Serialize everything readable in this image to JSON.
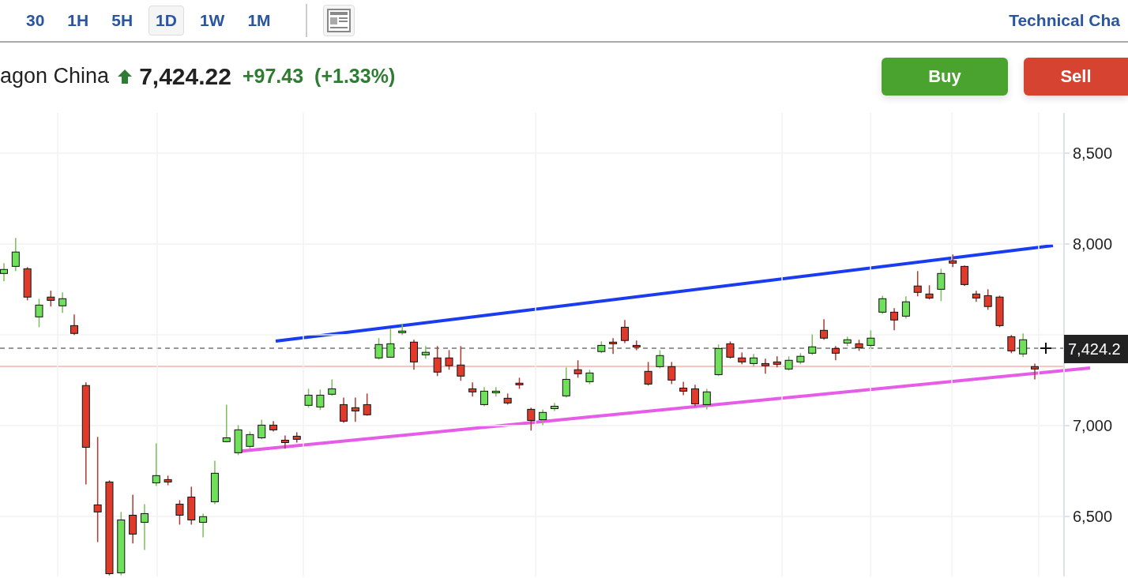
{
  "timeframes": [
    {
      "label": "30",
      "selected": false
    },
    {
      "label": "1H",
      "selected": false
    },
    {
      "label": "5H",
      "selected": false
    },
    {
      "label": "1D",
      "selected": true
    },
    {
      "label": "1W",
      "selected": false
    },
    {
      "label": "1M",
      "selected": false
    }
  ],
  "link": "Technical Cha",
  "quote": {
    "name": "agon China",
    "rising": true,
    "price": "7,424.22",
    "change": "+97.43",
    "change_percent": "(+1.33%)"
  },
  "actions": [
    {
      "label": "Buy",
      "kind": "buy"
    },
    {
      "label": "Sell",
      "kind": "sell"
    }
  ],
  "chart": {
    "last_price": "7,424.2",
    "trendlines": [
      {
        "color": "#1a3cf0"
      },
      {
        "color": "#e65ce8"
      }
    ],
    "chart_data": {
      "type": "candlestick",
      "grid": true,
      "ylim": [
        6170,
        8722
      ],
      "yticks": [
        {
          "value": 8500,
          "label": "8,500"
        },
        {
          "value": 8000,
          "label": "8,000"
        },
        {
          "value": 7000,
          "label": "7,000"
        },
        {
          "value": 6500,
          "label": "6,500"
        }
      ],
      "ohlc": [
        [
          7838,
          7895,
          7795,
          7860
        ],
        [
          7877,
          8034,
          7851,
          7956
        ],
        [
          7864,
          7873,
          7690,
          7708
        ],
        [
          7599,
          7699,
          7542,
          7664
        ],
        [
          7708,
          7743,
          7656,
          7690
        ],
        [
          7660,
          7734,
          7621,
          7699
        ],
        [
          7551,
          7612,
          7499,
          7508
        ],
        [
          7221,
          7238,
          6677,
          6881
        ],
        [
          6564,
          6938,
          6359,
          6525
        ],
        [
          6690,
          6699,
          6176,
          6185
        ],
        [
          6190,
          6525,
          6176,
          6481
        ],
        [
          6507,
          6620,
          6351,
          6403
        ],
        [
          6468,
          6568,
          6316,
          6516
        ],
        [
          6685,
          6903,
          6668,
          6725
        ],
        [
          6703,
          6725,
          6672,
          6690
        ],
        [
          6568,
          6590,
          6455,
          6507
        ],
        [
          6607,
          6664,
          6455,
          6481
        ],
        [
          6468,
          6516,
          6385,
          6499
        ],
        [
          6581,
          6807,
          6568,
          6738
        ],
        [
          6912,
          7116,
          6908,
          6933
        ],
        [
          6851,
          7003,
          6838,
          6977
        ],
        [
          6886,
          6968,
          6873,
          6951
        ],
        [
          6933,
          7033,
          6925,
          7003
        ],
        [
          7003,
          7025,
          6968,
          6977
        ],
        [
          6920,
          6946,
          6873,
          6907
        ],
        [
          6942,
          6964,
          6907,
          6925
        ],
        [
          7112,
          7203,
          7099,
          7168
        ],
        [
          7103,
          7199,
          7086,
          7168
        ],
        [
          7173,
          7255,
          7164,
          7203
        ],
        [
          7116,
          7155,
          7016,
          7025
        ],
        [
          7099,
          7155,
          7021,
          7081
        ],
        [
          7116,
          7177,
          7055,
          7060
        ],
        [
          7373,
          7482,
          7364,
          7447
        ],
        [
          7377,
          7534,
          7373,
          7451
        ],
        [
          7512,
          7560,
          7499,
          7521
        ],
        [
          7460,
          7473,
          7308,
          7351
        ],
        [
          7390,
          7438,
          7369,
          7404
        ],
        [
          7373,
          7438,
          7273,
          7295
        ],
        [
          7373,
          7416,
          7308,
          7330
        ],
        [
          7334,
          7438,
          7247,
          7273
        ],
        [
          7203,
          7238,
          7160,
          7186
        ],
        [
          7116,
          7212,
          7107,
          7190
        ],
        [
          7181,
          7212,
          7160,
          7190
        ],
        [
          7151,
          7177,
          7116,
          7125
        ],
        [
          7234,
          7264,
          7203,
          7225
        ],
        [
          7090,
          7099,
          6973,
          7029
        ],
        [
          7033,
          7090,
          7003,
          7073
        ],
        [
          7094,
          7125,
          7081,
          7107
        ],
        [
          7164,
          7321,
          7155,
          7255
        ],
        [
          7308,
          7360,
          7264,
          7286
        ],
        [
          7242,
          7308,
          7229,
          7290
        ],
        [
          7408,
          7464,
          7399,
          7442
        ],
        [
          7460,
          7482,
          7395,
          7451
        ],
        [
          7542,
          7582,
          7455,
          7469
        ],
        [
          7442,
          7469,
          7416,
          7434
        ],
        [
          7299,
          7351,
          7221,
          7229
        ],
        [
          7325,
          7416,
          7316,
          7386
        ],
        [
          7325,
          7351,
          7229,
          7251
        ],
        [
          7207,
          7242,
          7168,
          7190
        ],
        [
          7203,
          7225,
          7107,
          7120
        ],
        [
          7116,
          7203,
          7090,
          7186
        ],
        [
          7281,
          7447,
          7273,
          7425
        ],
        [
          7451,
          7464,
          7369,
          7377
        ],
        [
          7373,
          7403,
          7338,
          7351
        ],
        [
          7342,
          7395,
          7325,
          7373
        ],
        [
          7342,
          7369,
          7286,
          7330
        ],
        [
          7351,
          7382,
          7321,
          7338
        ],
        [
          7312,
          7382,
          7303,
          7360
        ],
        [
          7351,
          7399,
          7338,
          7382
        ],
        [
          7399,
          7503,
          7390,
          7434
        ],
        [
          7525,
          7586,
          7473,
          7482
        ],
        [
          7425,
          7438,
          7360,
          7399
        ],
        [
          7455,
          7490,
          7438,
          7473
        ],
        [
          7451,
          7473,
          7412,
          7429
        ],
        [
          7442,
          7525,
          7429,
          7482
        ],
        [
          7625,
          7716,
          7616,
          7699
        ],
        [
          7625,
          7647,
          7525,
          7582
        ],
        [
          7603,
          7712,
          7590,
          7682
        ],
        [
          7769,
          7851,
          7712,
          7734
        ],
        [
          7725,
          7773,
          7695,
          7703
        ],
        [
          7751,
          7864,
          7686,
          7838
        ],
        [
          7908,
          7943,
          7873,
          7895
        ],
        [
          7877,
          7882,
          7769,
          7777
        ],
        [
          7725,
          7743,
          7682,
          7703
        ],
        [
          7716,
          7751,
          7638,
          7656
        ],
        [
          7708,
          7716,
          7542,
          7551
        ],
        [
          7490,
          7499,
          7399,
          7412
        ],
        [
          7395,
          7508,
          7377,
          7473
        ],
        [
          7325,
          7342,
          7255,
          7312
        ]
      ]
    }
  }
}
